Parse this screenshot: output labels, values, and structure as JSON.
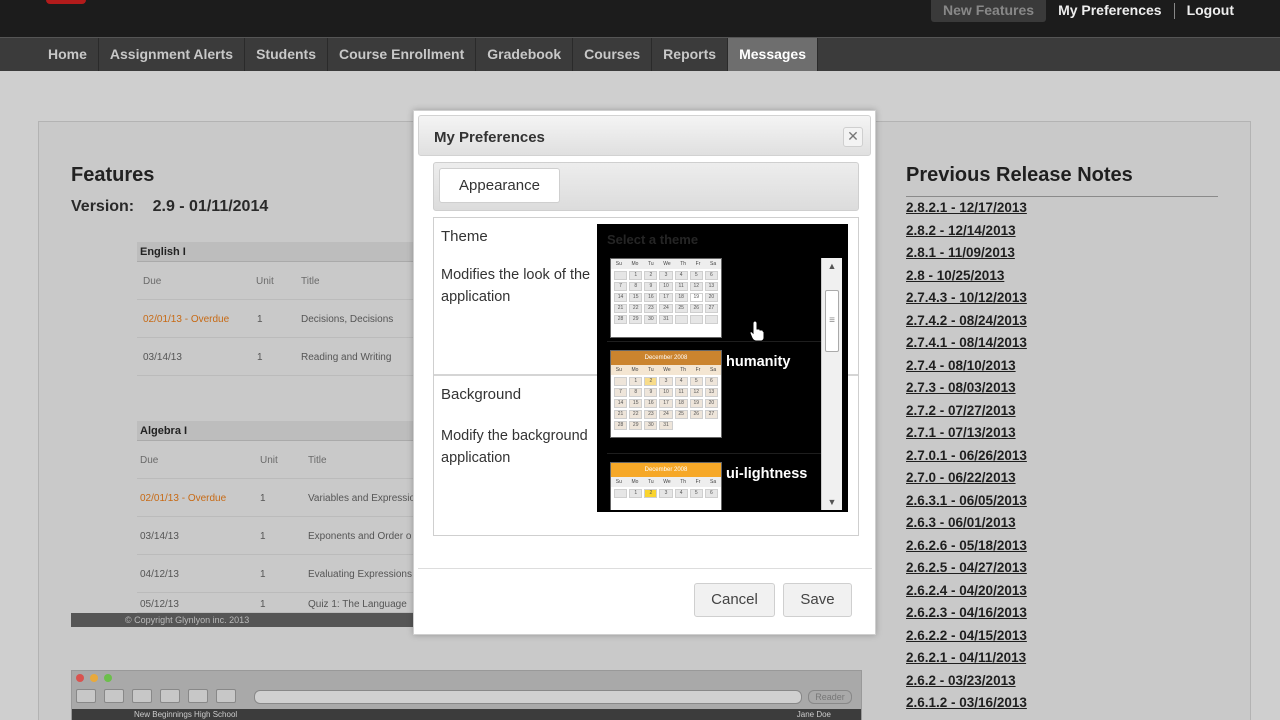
{
  "topbar": {
    "links": [
      "New Features",
      "My Preferences",
      "Logout"
    ]
  },
  "nav": {
    "items": [
      "Home",
      "Assignment Alerts",
      "Students",
      "Course Enrollment",
      "Gradebook",
      "Courses",
      "Reports",
      "Messages"
    ],
    "active": "Messages"
  },
  "features": {
    "title": "Features",
    "version_label": "Version:",
    "version_value": "2.9 - 01/11/2014"
  },
  "preview": {
    "english": {
      "course": "English I",
      "headers": [
        "Due",
        "Unit",
        "Title"
      ],
      "rows": [
        {
          "due": "02/01/13 - Overdue",
          "unit": "1",
          "title": "Decisions, Decisions"
        },
        {
          "due": "03/14/13",
          "unit": "1",
          "title": "Reading and Writing"
        }
      ]
    },
    "algebra": {
      "course": "Algebra I",
      "headers": [
        "Due",
        "Unit",
        "Title"
      ],
      "rows": [
        {
          "due": "02/01/13 - Overdue",
          "unit": "1",
          "title": "Variables and Expressio"
        },
        {
          "due": "03/14/13",
          "unit": "1",
          "title": "Exponents and Order o"
        },
        {
          "due": "04/12/13",
          "unit": "1",
          "title": "Evaluating Expressions"
        },
        {
          "due": "05/12/13",
          "unit": "1",
          "title": "Quiz 1: The Language"
        }
      ]
    },
    "copyright": "© Copyright  Glynlyon inc. 2013",
    "browser": {
      "reader": "Reader",
      "school": "New Beginnings High School",
      "user": "Jane Doe"
    }
  },
  "release_notes": {
    "title": "Previous Release Notes",
    "items": [
      "2.8.2.1 - 12/17/2013",
      "2.8.2 - 12/14/2013",
      "2.8.1 - 11/09/2013",
      "2.8 - 10/25/2013",
      "2.7.4.3 - 10/12/2013",
      "2.7.4.2 - 08/24/2013",
      "2.7.4.1 - 08/14/2013",
      "2.7.4 - 08/10/2013",
      "2.7.3 - 08/03/2013",
      "2.7.2 - 07/27/2013",
      "2.7.1 - 07/13/2013",
      "2.7.0.1 - 06/26/2013",
      "2.7.0 - 06/22/2013",
      "2.6.3.1 - 06/05/2013",
      "2.6.3 - 06/01/2013",
      "2.6.2.6 - 05/18/2013",
      "2.6.2.5 - 04/27/2013",
      "2.6.2.4 - 04/20/2013",
      "2.6.2.3 - 04/16/2013",
      "2.6.2.2 - 04/15/2013",
      "2.6.2.1 - 04/11/2013",
      "2.6.2 - 03/23/2013",
      "2.6.1.2 - 03/16/2013"
    ]
  },
  "modal": {
    "title": "My Preferences",
    "close_icon": "close-icon",
    "tab": "Appearance",
    "theme_label": "Theme",
    "theme_desc": "Modifies the look of the application",
    "background_label": "Background",
    "background_desc": "Modify the background application",
    "cancel": "Cancel",
    "save": "Save"
  },
  "theme_dropdown": {
    "header": "Select a theme",
    "options": [
      {
        "name": "",
        "accent": "#d4d4d4"
      },
      {
        "name": "humanity",
        "accent": "#cb842e"
      },
      {
        "name": "ui-lightness",
        "accent": "#f6a828"
      }
    ]
  }
}
